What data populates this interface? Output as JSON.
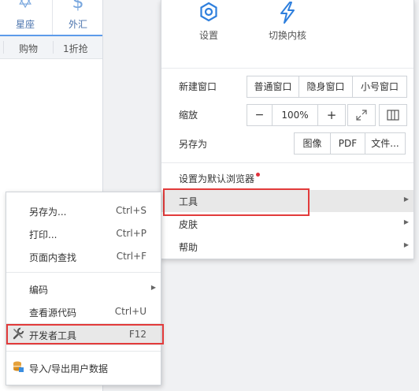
{
  "background": {
    "top_icons": [
      {
        "icon": "star-of-david-icon",
        "label": "星座"
      },
      {
        "icon": "dollar-icon",
        "label": "外汇"
      }
    ],
    "row2": [
      "购物",
      "1折抢"
    ]
  },
  "main_menu": {
    "top_actions": [
      {
        "icon": "gear-icon",
        "label": "设置"
      },
      {
        "icon": "lightning-icon",
        "label": "切换内核"
      }
    ],
    "new_window": {
      "label": "新建窗口",
      "options": [
        "普通窗口",
        "隐身窗口",
        "小号窗口"
      ]
    },
    "zoom": {
      "label": "缩放",
      "minus": "−",
      "value": "100%",
      "plus": "+"
    },
    "save_as": {
      "label": "另存为",
      "options": [
        "图像",
        "PDF",
        "文件..."
      ]
    },
    "items": [
      {
        "label": "设置为默认浏览器",
        "badge": true
      },
      {
        "label": "工具",
        "submenu": true
      },
      {
        "label": "皮肤",
        "submenu": true
      },
      {
        "label": "帮助",
        "submenu": true
      }
    ]
  },
  "tools_submenu": {
    "items": [
      {
        "label": "另存为...",
        "shortcut": "Ctrl+S"
      },
      {
        "label": "打印...",
        "shortcut": "Ctrl+P"
      },
      {
        "label": "页面内查找",
        "shortcut": "Ctrl+F"
      },
      {
        "label": "编码",
        "shortcut": ""
      },
      {
        "label": "查看源代码",
        "shortcut": "Ctrl+U"
      },
      {
        "label": "开发者工具",
        "shortcut": "F12"
      },
      {
        "label": "导入/导出用户数据",
        "shortcut": ""
      }
    ]
  },
  "colors": {
    "accent": "#2e7fdd",
    "highlight_box": "#e23b3b",
    "badge": "#e0313b"
  }
}
